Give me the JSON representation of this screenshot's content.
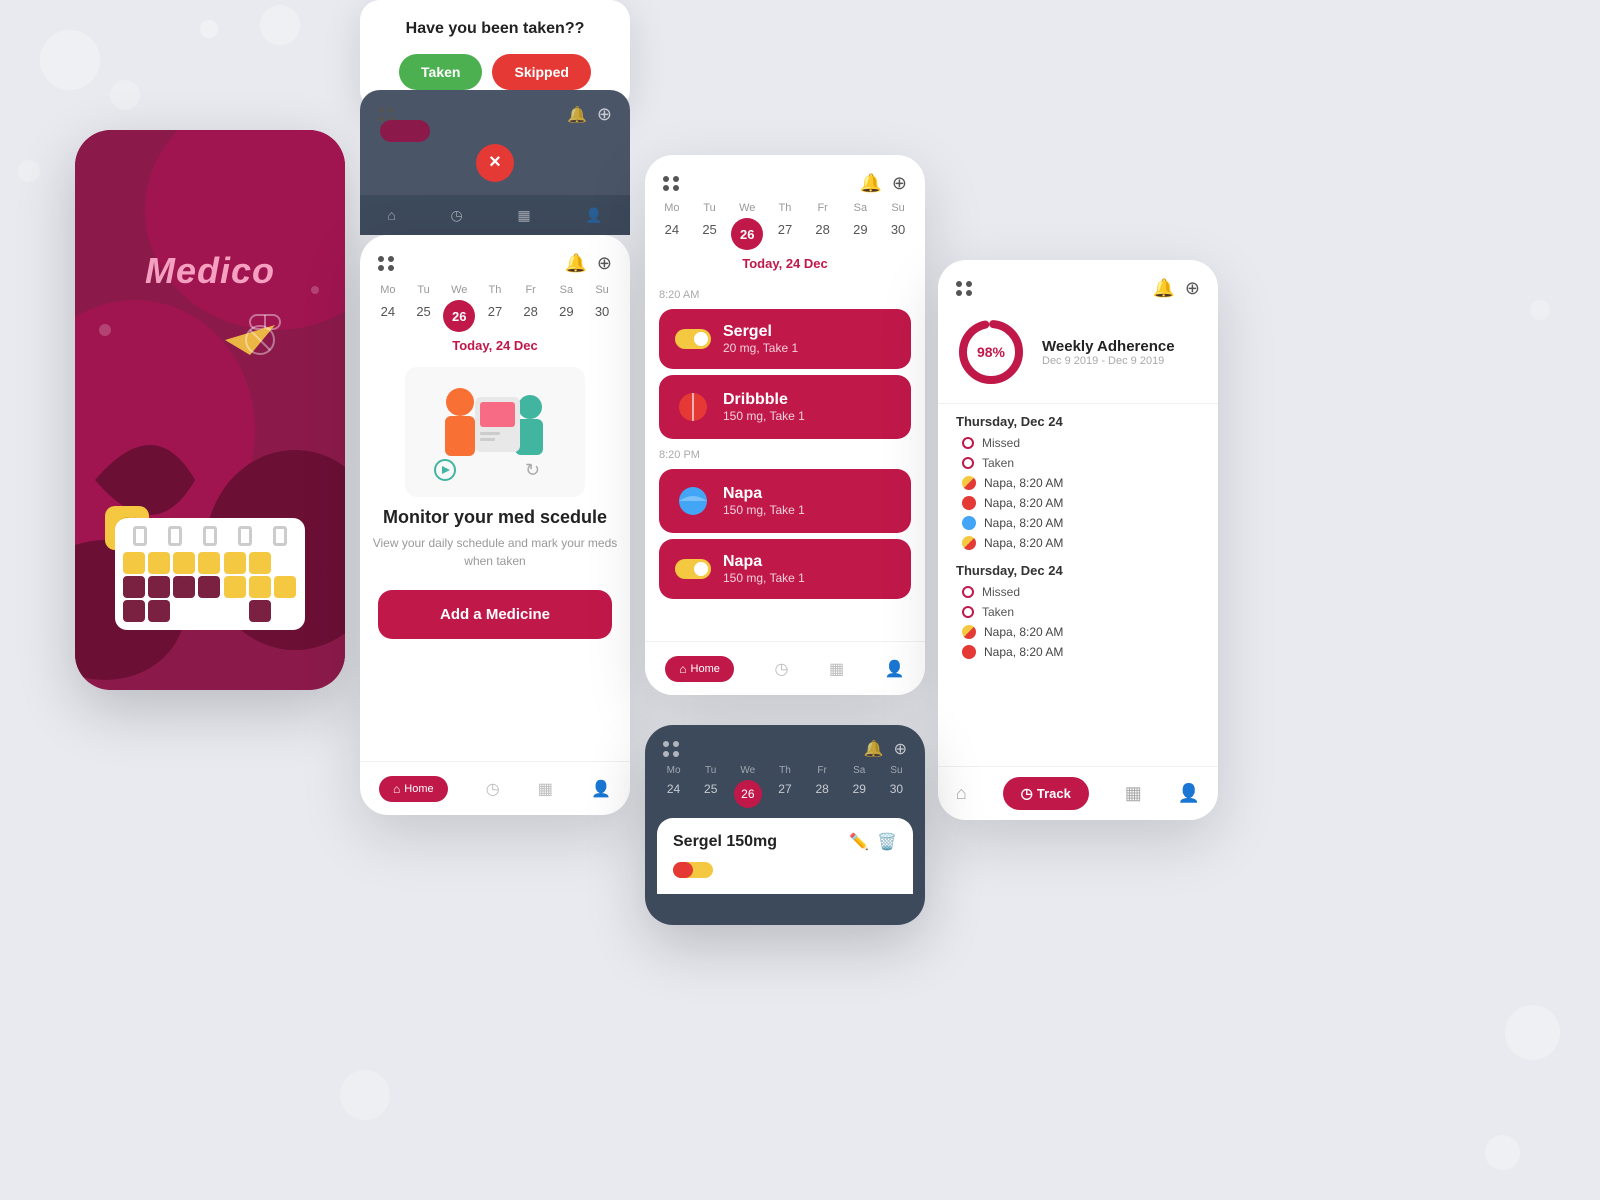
{
  "app": {
    "name": "Medico",
    "background": "#e8eaf0"
  },
  "popup": {
    "title": "Have you been taken??",
    "btn_taken": "Taken",
    "btn_skipped": "Skipped"
  },
  "calendar": {
    "today_label": "Today, 24 Dec",
    "days": [
      "Mo",
      "Tu",
      "We",
      "Th",
      "Fr",
      "Sa",
      "Su"
    ],
    "dates": [
      "24",
      "25",
      "26",
      "27",
      "28",
      "29",
      "30"
    ],
    "active_date": "26",
    "active_day": "We"
  },
  "phone3": {
    "monitor_title": "Monitor your med scedule",
    "monitor_sub": "View your daily schedule and mark\nyour meds when taken",
    "add_btn": "Add a Medicine"
  },
  "phone4": {
    "date_label": "Today, 24 Dec",
    "time1": "8:20 AM",
    "time2": "8:20 PM",
    "meds": [
      {
        "name": "Sergel",
        "dose": "20 mg, Take 1",
        "color": "#f5c842",
        "toggle": true
      },
      {
        "name": "Dribbble",
        "dose": "150 mg, Take 1",
        "color": "#e53935",
        "toggle": false
      },
      {
        "name": "Napa",
        "dose": "150 mg, Take 1",
        "color": "#42a5f5",
        "toggle": false
      },
      {
        "name": "Napa",
        "dose": "150 mg, Take 1",
        "color": "#f5c842",
        "toggle": true
      }
    ]
  },
  "phone5": {
    "adherence_pct": "98%",
    "adherence_title": "Weekly Adherence",
    "adherence_date": "Dec 9 2019 - Dec 9 2019",
    "sections": [
      {
        "day": "Thursday, Dec 24",
        "statuses": [
          "Missed",
          "Taken"
        ],
        "items": [
          {
            "name": "Napa, 8:20 AM",
            "color": "#f5c842"
          },
          {
            "name": "Napa, 8:20 AM",
            "color": "#e53935"
          },
          {
            "name": "Napa, 8:20 AM",
            "color": "#42a5f5"
          },
          {
            "name": "Napa, 8:20 AM",
            "color": "#f5c842"
          }
        ]
      },
      {
        "day": "Thursday, Dec 24",
        "statuses": [
          "Missed",
          "Taken"
        ],
        "items": [
          {
            "name": "Napa, 8:20 AM",
            "color": "#f5c842"
          },
          {
            "name": "Napa, 8:20 AM",
            "color": "#e53935"
          }
        ]
      }
    ],
    "nav_track": "Track"
  },
  "phone6": {
    "med_name": "Sergel 150mg"
  }
}
